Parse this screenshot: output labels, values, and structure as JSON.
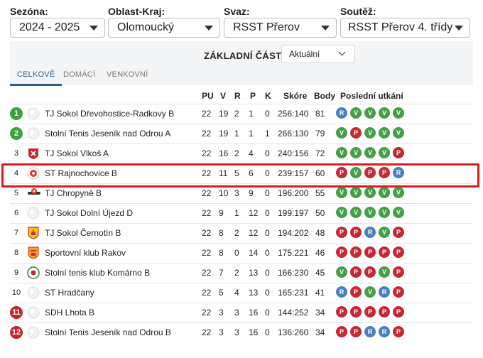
{
  "filters": [
    {
      "label": "Sezóna:",
      "value": "2024 - 2025"
    },
    {
      "label": "Oblast-Kraj:",
      "value": "Olomoucký"
    },
    {
      "label": "Svaz:",
      "value": "RSST Přerov"
    },
    {
      "label": "Soutěž:",
      "value": "RSST Přerov 4. třídy"
    }
  ],
  "phase": {
    "title": "ZÁKLADNÍ ČÁST",
    "select_value": "Aktuální"
  },
  "tabs": [
    {
      "label": "CELKOVĚ",
      "active": true
    },
    {
      "label": "DOMÁCÍ",
      "active": false
    },
    {
      "label": "VENKOVNÍ",
      "active": false
    }
  ],
  "columns": {
    "pu": "PU",
    "v": "V",
    "r": "R",
    "p": "P",
    "k": "K",
    "skore": "Skóre",
    "body": "Body",
    "form": "Poslední utkání"
  },
  "colors": {
    "win": "#43a047",
    "loss": "#c62835",
    "draw": "#4a7fc0",
    "promotion": "#3ca33c",
    "relegation": "#c9232c",
    "tab_active": "#2d5f8b",
    "highlight": "#e3171e"
  },
  "rows": [
    {
      "rank": "1",
      "zone": "promo",
      "logo": "ball",
      "team": "TJ Sokol Dřevohostice-Radkovy B",
      "pu": "22",
      "v": "19",
      "r": "2",
      "p": "1",
      "k": "0",
      "skore": "256:140",
      "body": "81",
      "form": [
        "R",
        "V",
        "V",
        "V",
        "V"
      ]
    },
    {
      "rank": "2",
      "zone": "promo",
      "logo": "ball",
      "team": "Stolní Tenis Jeseník nad Odrou A",
      "pu": "22",
      "v": "19",
      "r": "1",
      "p": "1",
      "k": "1",
      "skore": "266:130",
      "body": "79",
      "form": [
        "V",
        "P",
        "V",
        "V",
        "V"
      ]
    },
    {
      "rank": "3",
      "zone": "",
      "logo": "crest-red",
      "team": "TJ Sokol Vlkoš A",
      "pu": "22",
      "v": "16",
      "r": "2",
      "p": "4",
      "k": "0",
      "skore": "240:156",
      "body": "72",
      "form": [
        "V",
        "V",
        "V",
        "V",
        "P"
      ]
    },
    {
      "rank": "4",
      "zone": "",
      "logo": "target",
      "team": "ST Rajnochovice B",
      "pu": "22",
      "v": "11",
      "r": "5",
      "p": "6",
      "k": "0",
      "skore": "239:157",
      "body": "60",
      "form": [
        "P",
        "V",
        "P",
        "P",
        "R"
      ]
    },
    {
      "rank": "5",
      "zone": "",
      "logo": "wing",
      "team": "TJ Chropyně B",
      "pu": "22",
      "v": "10",
      "r": "3",
      "p": "9",
      "k": "0",
      "skore": "196:200",
      "body": "55",
      "form": [
        "V",
        "V",
        "V",
        "V",
        "V"
      ]
    },
    {
      "rank": "6",
      "zone": "",
      "logo": "ball",
      "team": "TJ Sokol Dolní Újezd D",
      "pu": "22",
      "v": "9",
      "r": "1",
      "p": "12",
      "k": "0",
      "skore": "199:197",
      "body": "50",
      "form": [
        "V",
        "V",
        "V",
        "V",
        "V"
      ]
    },
    {
      "rank": "7",
      "zone": "",
      "logo": "shield-yellow",
      "team": "TJ Sokol Černotín B",
      "pu": "22",
      "v": "8",
      "r": "2",
      "p": "12",
      "k": "0",
      "skore": "194:202",
      "body": "48",
      "form": [
        "P",
        "P",
        "R",
        "V",
        "P"
      ]
    },
    {
      "rank": "8",
      "zone": "",
      "logo": "shield-orange",
      "team": "Sportovní klub Rakov",
      "pu": "22",
      "v": "8",
      "r": "0",
      "p": "14",
      "k": "0",
      "skore": "175:221",
      "body": "46",
      "form": [
        "P",
        "P",
        "P",
        "P",
        "P"
      ]
    },
    {
      "rank": "9",
      "zone": "",
      "logo": "round-green",
      "team": "Stolní tenis klub Komárno B",
      "pu": "22",
      "v": "7",
      "r": "2",
      "p": "13",
      "k": "0",
      "skore": "166:230",
      "body": "45",
      "form": [
        "V",
        "P",
        "P",
        "V",
        "P"
      ]
    },
    {
      "rank": "10",
      "zone": "",
      "logo": "ball",
      "team": "ST Hradčany",
      "pu": "22",
      "v": "5",
      "r": "4",
      "p": "13",
      "k": "0",
      "skore": "165:231",
      "body": "41",
      "form": [
        "R",
        "P",
        "V",
        "R",
        "P"
      ]
    },
    {
      "rank": "11",
      "zone": "releg",
      "logo": "ball",
      "team": "SDH Lhota B",
      "pu": "22",
      "v": "3",
      "r": "3",
      "p": "16",
      "k": "0",
      "skore": "144:252",
      "body": "34",
      "form": [
        "P",
        "P",
        "P",
        "P",
        "P"
      ]
    },
    {
      "rank": "12",
      "zone": "releg",
      "logo": "ball",
      "team": "Stolní Tenis Jeseník nad Odrou B",
      "pu": "22",
      "v": "3",
      "r": "3",
      "p": "16",
      "k": "0",
      "skore": "136:260",
      "body": "34",
      "form": [
        "P",
        "P",
        "R",
        "R",
        "P"
      ]
    }
  ]
}
